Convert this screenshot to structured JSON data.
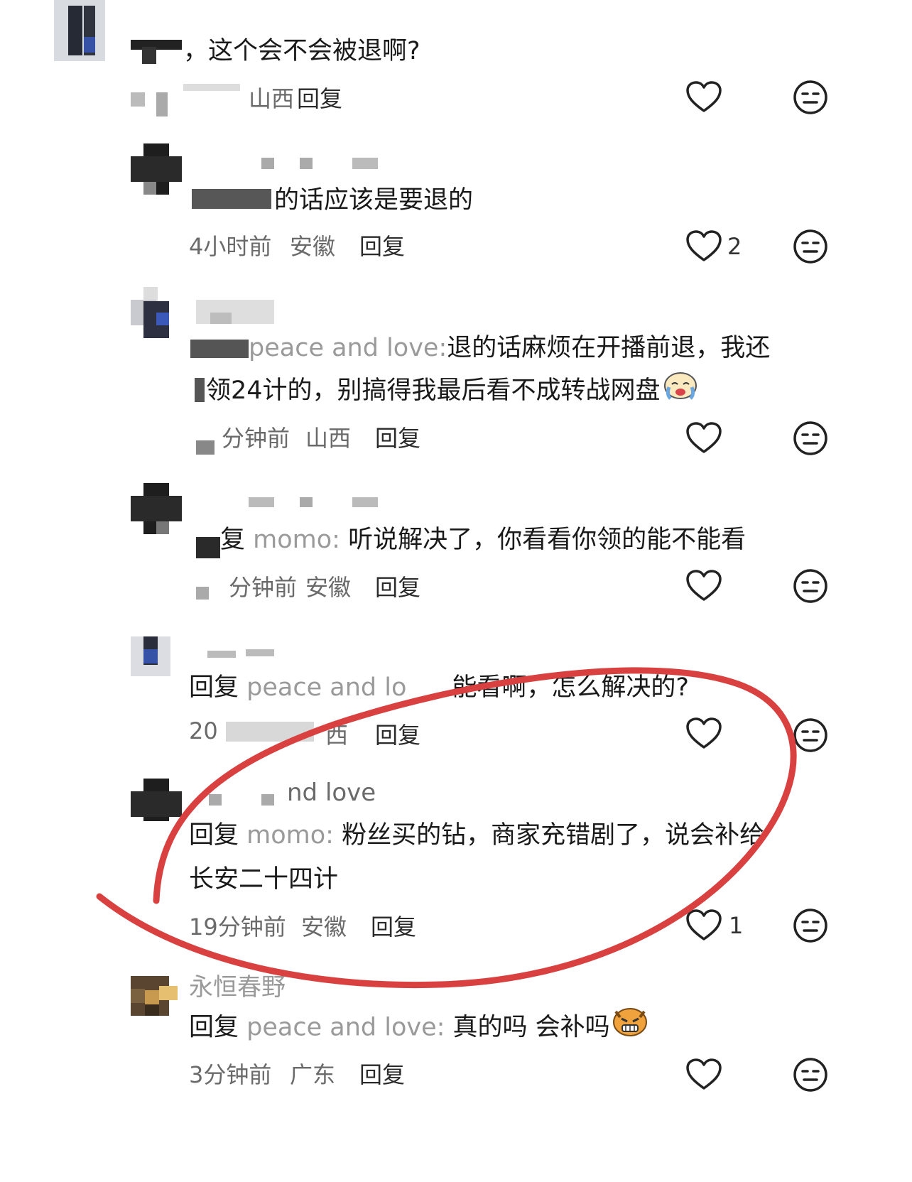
{
  "comments": [
    {
      "text": "，这个会不会被退啊?",
      "meta": {
        "time": "",
        "location": "山西",
        "reply": "回复"
      },
      "likes": ""
    },
    {
      "text": "的话应该是要退的",
      "meta": {
        "time": "4小时前",
        "location": "安徽",
        "reply": "回复"
      },
      "likes": "2"
    },
    {
      "reply_prefix": "",
      "reply_to": "peace and love:",
      "text_line1": "退的话麻烦在开播前退，我还",
      "text_line2": "领24计的，别搞得我最后看不成转战网盘",
      "meta": {
        "time": "分钟前",
        "location": "山西",
        "reply": "回复"
      },
      "likes": ""
    },
    {
      "reply_prefix": "复",
      "reply_to": "momo:",
      "text": "听说解决了，你看看你领的能不能看",
      "meta": {
        "time": "分钟前",
        "location": "安徽",
        "reply": "回复"
      },
      "likes": ""
    },
    {
      "reply_prefix": "回复",
      "reply_to": "peace and lo",
      "text": "能看啊，怎么解决的?",
      "meta": {
        "time": "20",
        "location": "西",
        "reply": "回复"
      },
      "likes": ""
    },
    {
      "username_partial": "nd love",
      "reply_prefix": "回复",
      "reply_to": "momo:",
      "text_line1": "粉丝买的钻，商家充错剧了，说会补给",
      "text_line2": "长安二十四计",
      "meta": {
        "time": "19分钟前",
        "location": "安徽",
        "reply": "回复"
      },
      "likes": "1"
    },
    {
      "username": "永恒春野",
      "reply_prefix": "回复",
      "reply_to": "peace and love:",
      "text": "真的吗 会补吗",
      "meta": {
        "time": "3分钟前",
        "location": "广东",
        "reply": "回复"
      },
      "likes": ""
    }
  ],
  "icons": {
    "like": "heart-outline-icon",
    "dislike": "meh-face-icon",
    "emoji_crying": "crying-face-emoji",
    "emoji_tiger": "angry-tiger-emoji"
  },
  "annotation_color": "#d94040"
}
